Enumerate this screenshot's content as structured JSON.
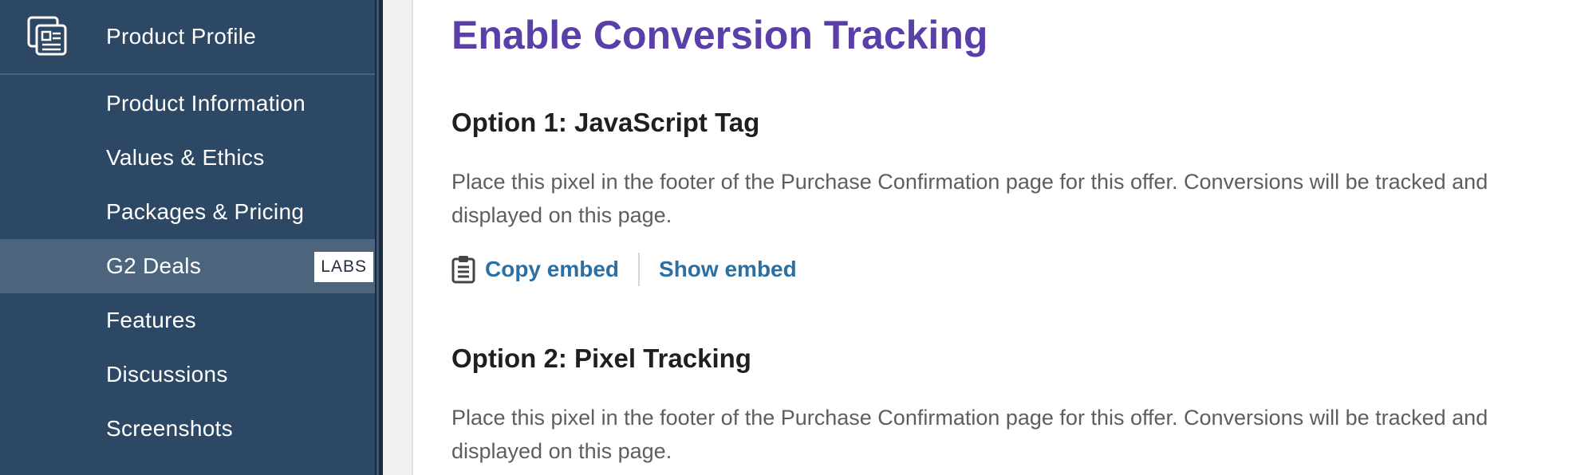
{
  "sidebar": {
    "header": {
      "icon": "product-profile-icon",
      "label": "Product Profile"
    },
    "items": [
      {
        "label": "Product Information",
        "active": false
      },
      {
        "label": "Values & Ethics",
        "active": false
      },
      {
        "label": "Packages & Pricing",
        "active": false
      },
      {
        "label": "G2 Deals",
        "active": true,
        "badge": "LABS"
      },
      {
        "label": "Features",
        "active": false
      },
      {
        "label": "Discussions",
        "active": false
      },
      {
        "label": "Screenshots",
        "active": false
      }
    ]
  },
  "main": {
    "title": "Enable Conversion Tracking",
    "option1": {
      "title": "Option 1: JavaScript Tag",
      "description": "Place this pixel in the footer of the Purchase Confirmation page for this offer. Conversions will be tracked and displayed on this page.",
      "copy_label": "Copy embed",
      "copy_icon": "clipboard-icon",
      "show_label": "Show embed"
    },
    "option2": {
      "title": "Option 2: Pixel Tracking",
      "description": "Place this pixel in the footer of the Purchase Confirmation page for this offer. Conversions will be tracked and displayed on this page."
    }
  },
  "colors": {
    "sidebar_bg": "#2d4864",
    "sidebar_active_bg": "#4d647d",
    "title_purple": "#5a3fa8",
    "link_blue": "#2b6fa3",
    "body_text": "#5e5e5e"
  }
}
